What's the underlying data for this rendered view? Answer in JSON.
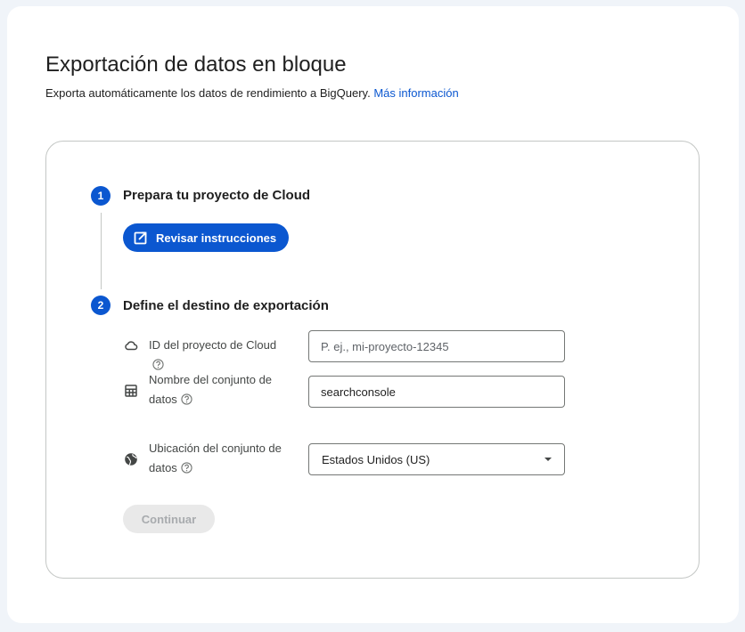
{
  "header": {
    "title": "Exportación de datos en bloque",
    "subtitle": "Exporta automáticamente los datos de rendimiento a BigQuery.",
    "link_label": "Más información"
  },
  "steps": [
    {
      "number": "1",
      "title": "Prepara tu proyecto de Cloud",
      "button_label": "Revisar instrucciones"
    },
    {
      "number": "2",
      "title": "Define el destino de exportación"
    }
  ],
  "form": {
    "project_id": {
      "label": "ID del proyecto de Cloud",
      "placeholder": "P. ej., mi-proyecto-12345",
      "value": "",
      "icon": "cloud-icon"
    },
    "dataset_name": {
      "label_line1": "Nombre del conjunto de",
      "label_line2": "datos",
      "value": "searchconsole",
      "icon": "table-icon"
    },
    "dataset_location": {
      "label_line1": "Ubicación del conjunto de",
      "label_line2": "datos",
      "value": "Estados Unidos (US)",
      "icon": "globe-icon"
    },
    "continue_label": "Continuar"
  },
  "colors": {
    "primary": "#0b57d0",
    "background": "#f0f4f9",
    "disabled_bg": "#e9e9e9"
  }
}
